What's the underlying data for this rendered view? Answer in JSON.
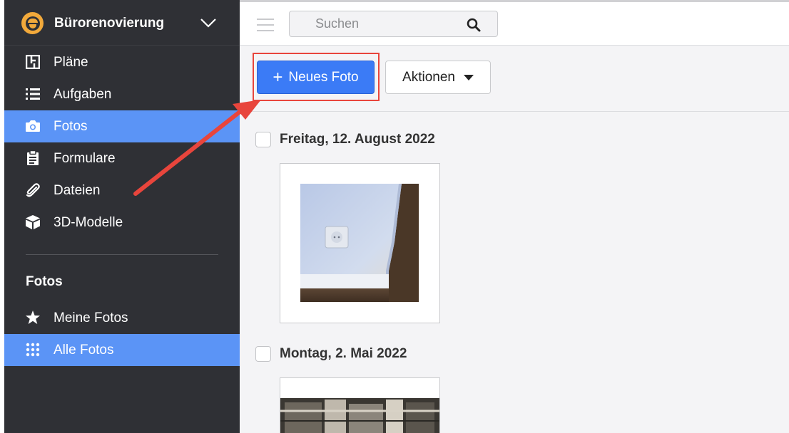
{
  "project": {
    "title": "Bürorenovierung",
    "logo_icon": "helmet-logo-icon"
  },
  "nav": {
    "items": [
      {
        "label": "Pläne",
        "icon": "floorplan-icon"
      },
      {
        "label": "Aufgaben",
        "icon": "list-icon"
      },
      {
        "label": "Fotos",
        "icon": "camera-icon",
        "active": true
      },
      {
        "label": "Formulare",
        "icon": "clipboard-icon"
      },
      {
        "label": "Dateien",
        "icon": "paperclip-icon"
      },
      {
        "label": "3D-Modelle",
        "icon": "cube-icon"
      }
    ],
    "section_title": "Fotos",
    "sub_items": [
      {
        "label": "Meine Fotos",
        "icon": "star-icon"
      },
      {
        "label": "Alle Fotos",
        "icon": "grid-icon",
        "active": true
      }
    ]
  },
  "search": {
    "placeholder": "Suchen"
  },
  "toolbar": {
    "new_photo_label": "Neues Foto",
    "actions_label": "Aktionen"
  },
  "photo_groups": [
    {
      "date": "Freitag, 12. August 2022"
    },
    {
      "date": "Montag, 2. Mai 2022"
    }
  ],
  "colors": {
    "sidebar_bg": "#2f3035",
    "active_item": "#5b94f6",
    "primary_button": "#3b7bf6",
    "highlight": "#e8453c",
    "logo": "#f2a93b"
  }
}
